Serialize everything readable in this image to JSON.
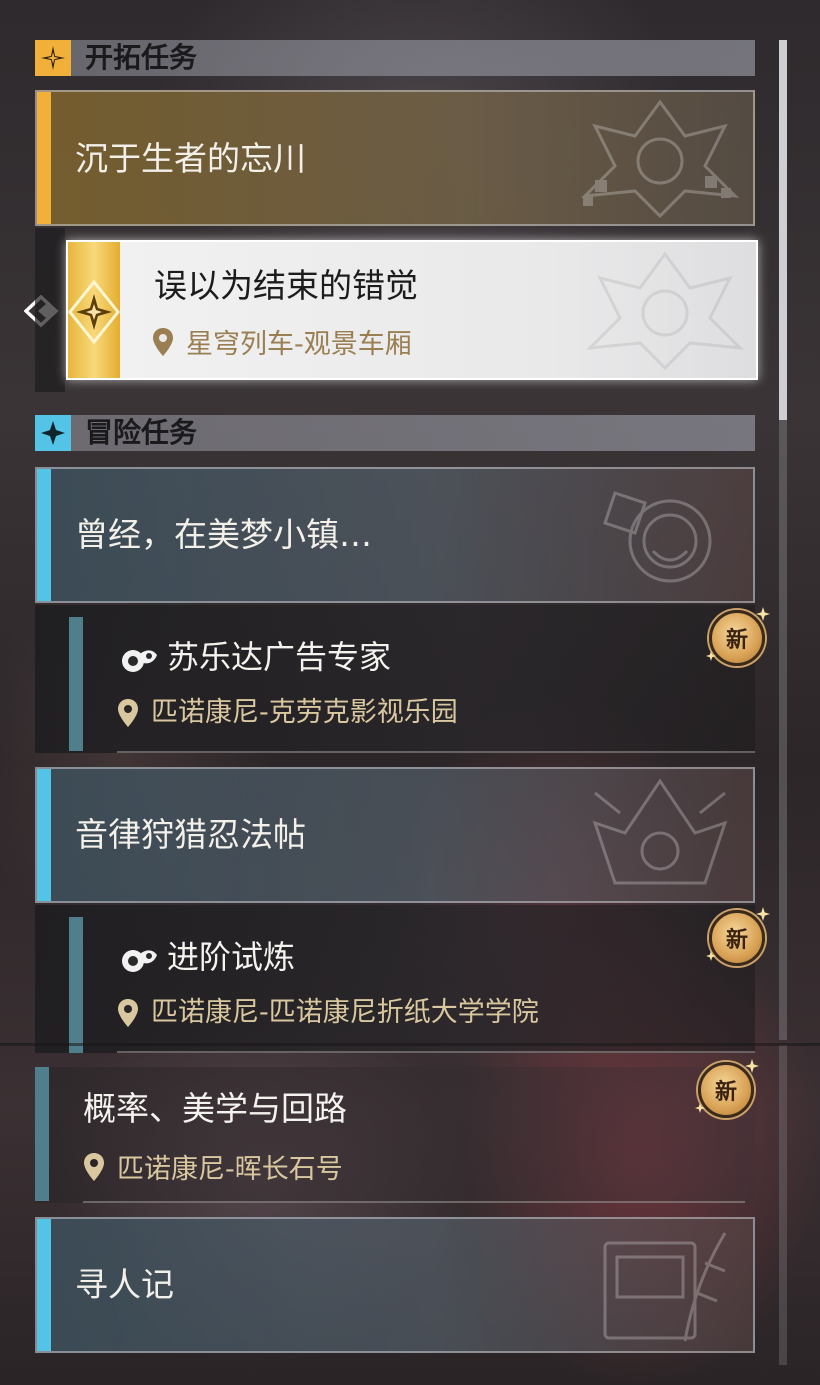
{
  "sections": {
    "trailblaze": {
      "label": "开拓任务"
    },
    "adventure": {
      "label": "冒险任务"
    }
  },
  "trailblaze_quest": {
    "title": "沉于生者的忘川",
    "selected_sub": {
      "title": "误以为结束的错觉",
      "location": "星穹列车-观景车厢"
    }
  },
  "adventure_quests": {
    "q1": {
      "title": "曾经，在美梦小镇…",
      "sub": {
        "title": "苏乐达广告专家",
        "location": "匹诺康尼-克劳克影视乐园",
        "badge": "新"
      }
    },
    "q2": {
      "title": "音律狩猎忍法帖",
      "sub": {
        "title": "进阶试炼",
        "location": "匹诺康尼-匹诺康尼折纸大学学院",
        "badge": "新"
      }
    },
    "q3": {
      "title": "概率、美学与回路",
      "location": "匹诺康尼-晖长石号",
      "badge": "新"
    },
    "q4": {
      "title": "寻人记"
    }
  },
  "colors": {
    "trailblaze_accent": "#f0b03a",
    "adventure_accent": "#53c4e6",
    "location_text": "#d9c79f"
  },
  "icons": {
    "trailblaze_header": "compass-star-icon",
    "adventure_header": "four-point-star-icon",
    "selected_indicator": "diamond-arrow-icon",
    "location": "map-pin-icon",
    "quest_type": "adventure-quest-icon"
  }
}
